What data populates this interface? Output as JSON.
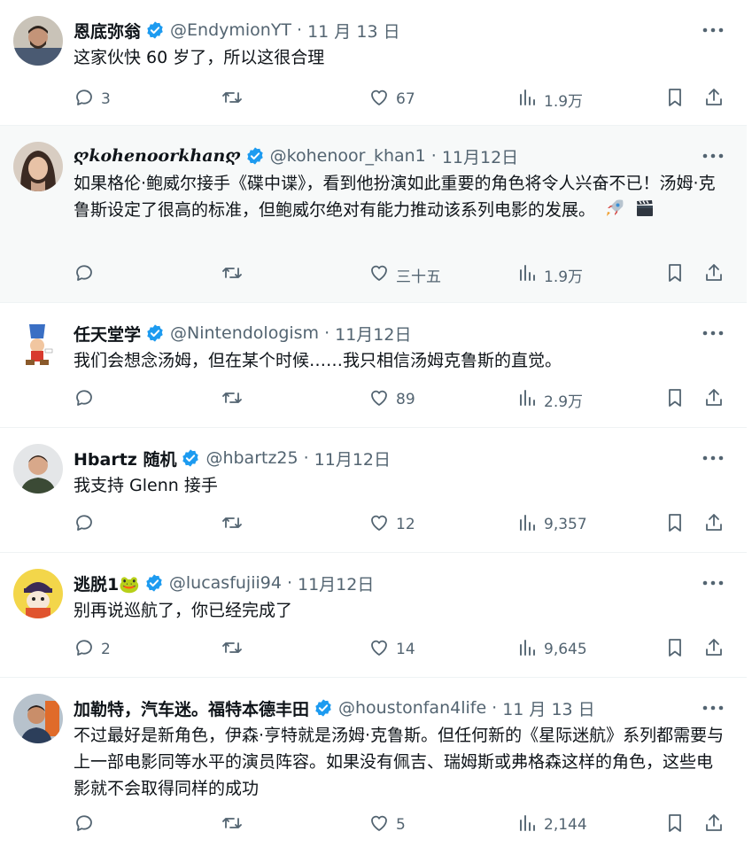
{
  "colors": {
    "verified_badge": "#1d9bf0",
    "icon_gray": "#536471",
    "text_primary": "#0f1419",
    "highlight_bg": "#f7f9f9"
  },
  "tweets": [
    {
      "name": "恩底弥翁",
      "handle": "@EndymionYT",
      "date": "11 月 13 日",
      "text": "这家伙快 60 岁了，所以这很合理",
      "emoji": "",
      "replies": "3",
      "retweets": "",
      "likes": "67",
      "views": "1.9万"
    },
    {
      "name": "ღkohenoorkhanღ",
      "handle": "@kohenoor_khan1",
      "date": "11月12日",
      "text": "如果格伦·鲍威尔接手《碟中谍》，看到他扮演如此重要的角色将令人兴奋不已！汤姆·克鲁斯设定了很高的标准，但鲍威尔绝对有能力推动该系列电影的发展。",
      "emoji": "rocket-clapper",
      "replies": "",
      "retweets": "",
      "likes": "三十五",
      "views": "1.9万"
    },
    {
      "name": "任天堂学",
      "handle": "@Nintendologism",
      "date": "11月12日",
      "text": "我们会想念汤姆，但在某个时候……我只相信汤姆克鲁斯的直觉。",
      "emoji": "",
      "replies": "",
      "retweets": "",
      "likes": "89",
      "views": "2.9万"
    },
    {
      "name": "Hbartz 随机",
      "handle": "@hbartz25",
      "date": "11月12日",
      "text": "我支持 Glenn 接手",
      "emoji": "",
      "replies": "",
      "retweets": "",
      "likes": "12",
      "views": "9,357"
    },
    {
      "name": "逃脱1🐸",
      "handle": "@lucasfujii94",
      "date": "11月12日",
      "text": "别再说巡航了，你已经完成了",
      "emoji": "",
      "replies": "2",
      "retweets": "",
      "likes": "14",
      "views": "9,645"
    },
    {
      "name": "加勒特，汽车迷。福特本德丰田",
      "handle": "@houstonfan4life",
      "date": "11 月 13 日",
      "text": "不过最好是新角色，伊森·亨特就是汤姆·克鲁斯。但任何新的《星际迷航》系列都需要与上一部电影同等水平的演员阵容。如果没有佩吉、瑞姆斯或弗格森这样的角色，这些电影就不会取得同样的成功",
      "emoji": "",
      "replies": "",
      "retweets": "",
      "likes": "5",
      "views": "2,144"
    }
  ]
}
